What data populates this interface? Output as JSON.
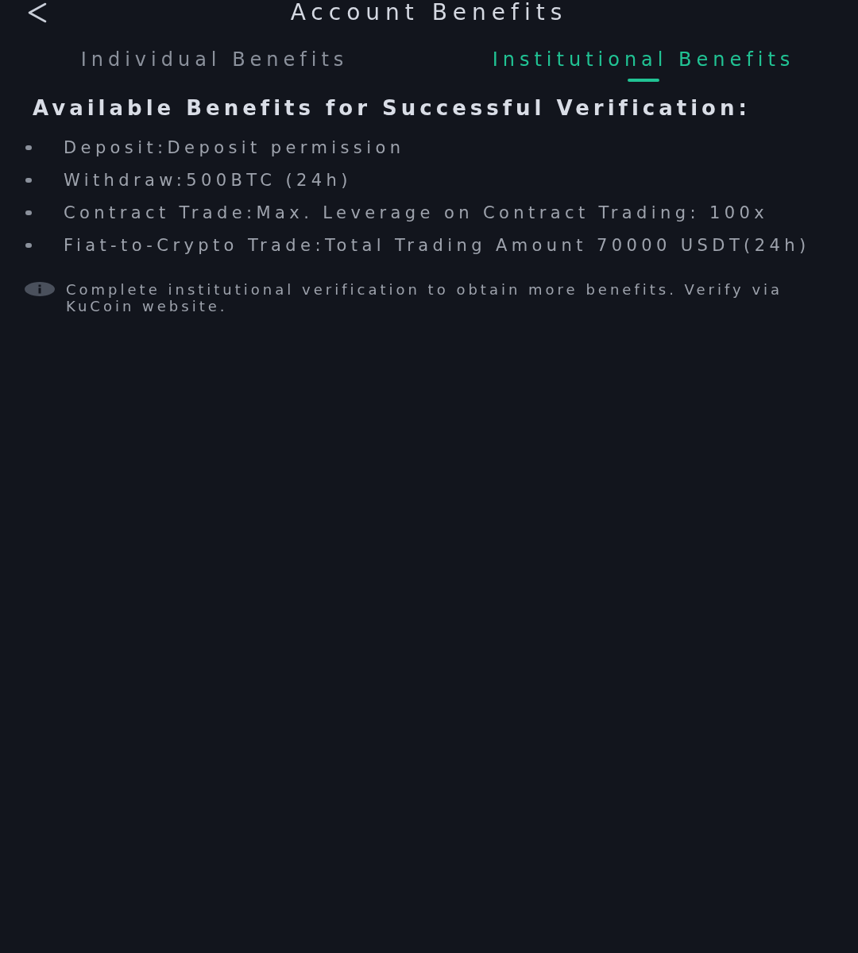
{
  "header": {
    "title": "Account Benefits"
  },
  "tabs": [
    {
      "label": "Individual Benefits",
      "selected": false
    },
    {
      "label": "Institutional Benefits",
      "selected": true
    }
  ],
  "section": {
    "heading": "Available Benefits for Successful Verification:",
    "benefits": [
      "Deposit:Deposit permission",
      "Withdraw:500BTC (24h)",
      "Contract Trade:Max. Leverage on Contract Trading: 100x",
      "Fiat-to-Crypto Trade:Total Trading Amount 70000 USDT(24h)"
    ]
  },
  "note": {
    "text": "Complete institutional verification to obtain more benefits. Verify via KuCoin website."
  }
}
